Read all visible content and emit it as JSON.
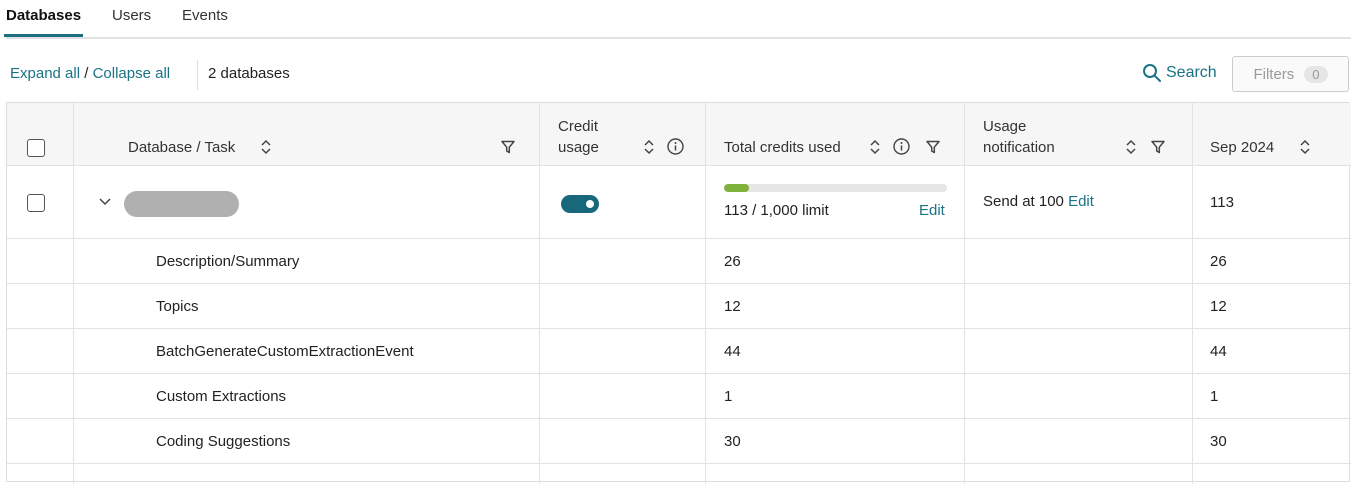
{
  "tabs": [
    {
      "label": "Databases",
      "active": true
    },
    {
      "label": "Users",
      "active": false
    },
    {
      "label": "Events",
      "active": false
    }
  ],
  "toolbar": {
    "expand_all": "Expand all",
    "separator": " / ",
    "collapse_all": "Collapse all",
    "database_count": "2 databases",
    "search_label": "Search",
    "filters_label": "Filters",
    "filters_count": "0"
  },
  "table": {
    "headers": {
      "database_task": "Database / Task",
      "credit_usage_line1": "Credit",
      "credit_usage_line2": "usage",
      "total_credits_used": "Total credits used",
      "usage_notification_line1": "Usage",
      "usage_notification_line2": "notification",
      "period": "Sep 2024"
    },
    "database_row": {
      "credit_usage_enabled": true,
      "usage_fraction": 0.113,
      "credits_text": "113 / 1,000 limit",
      "credits_edit": "Edit",
      "notification_text": "Send at 100",
      "notification_edit": "Edit",
      "period_value": "113"
    },
    "task_rows": [
      {
        "name": "Description/Summary",
        "total": "26",
        "period": "26"
      },
      {
        "name": "Topics",
        "total": "12",
        "period": "12"
      },
      {
        "name": "BatchGenerateCustomExtractionEvent",
        "total": "44",
        "period": "44"
      },
      {
        "name": "Custom Extractions",
        "total": "1",
        "period": "1"
      },
      {
        "name": "Coding Suggestions",
        "total": "30",
        "period": "30"
      }
    ]
  },
  "colors": {
    "accent": "#1a7285",
    "toggle_on": "#17687a",
    "progress_fill": "#7fb23a"
  }
}
